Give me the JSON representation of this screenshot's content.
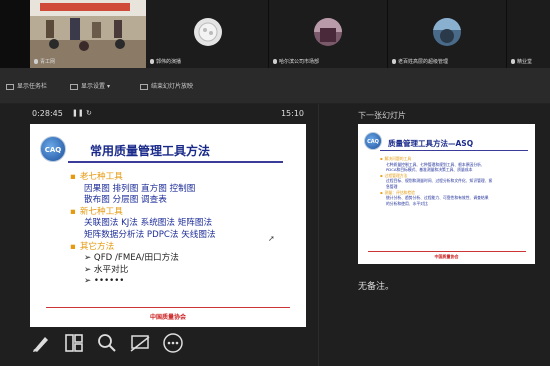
{
  "participants": [
    {
      "name": "青工网",
      "type": "video"
    },
    {
      "name": "郭伟的演播",
      "type": "avatar",
      "color": "#d8d8d8"
    },
    {
      "name": "哈尔滨公司市场部",
      "type": "avatar",
      "color": "#7a5a6a"
    },
    {
      "name": "老百姓高层的超级管理",
      "type": "avatar",
      "color": "#4a6a8a"
    },
    {
      "name": "精业堂",
      "type": "avatar",
      "color": "#3a3a3a"
    }
  ],
  "toolbar": {
    "item1": "显示任务栏",
    "item2": "显示设置",
    "item3": "结束幻灯片放映"
  },
  "presenter": {
    "elapsed": "0:28:45",
    "clock": "15:10",
    "pause_icon": "pause-icon",
    "restart_icon": "restart-icon"
  },
  "slide": {
    "logo": "CAQ",
    "title": "常用质量管理工具方法",
    "items": [
      {
        "kind": "head",
        "text": "老七种工具"
      },
      {
        "kind": "sub",
        "text": "因果图  排列图   直方图   控制图"
      },
      {
        "kind": "sub",
        "text": "散布图   分层图   调查表"
      },
      {
        "kind": "head",
        "text": "新七种工具"
      },
      {
        "kind": "sub",
        "text": "关联图法   KJ法    系统图法   矩阵图法"
      },
      {
        "kind": "sub",
        "text": "矩阵数据分析法   PDPC法   矢线图法"
      },
      {
        "kind": "head",
        "text": "其它方法"
      },
      {
        "kind": "arrow",
        "text": "➢ QFD /FMEA/田口方法"
      },
      {
        "kind": "arrow",
        "text": "➢ 水平对比"
      },
      {
        "kind": "arrow",
        "text": "➢ ••••••"
      }
    ],
    "footer": "中国质量协会"
  },
  "next_slide": {
    "label": "下一张幻灯片",
    "logo": "CAQ",
    "title": "质量管理工具方法—ASQ",
    "items": [
      {
        "kind": "h",
        "text": "解决问题的工具"
      },
      {
        "kind": "t",
        "text": "七种质量控制工具、七种管理和规划工具、根本原因分析、"
      },
      {
        "kind": "t",
        "text": "PDCA和目标模式、基准测量和决策工具、质量成本"
      },
      {
        "kind": "h",
        "text": "过程管理方法"
      },
      {
        "kind": "t",
        "text": "过程目标、规划和测量时间、过程分析和文件化、知识管理、紧"
      },
      {
        "kind": "t",
        "text": "急管理"
      },
      {
        "kind": "h",
        "text": "测量：评估和检验"
      },
      {
        "kind": "t",
        "text": "统计分析、趋势分析、过程能力、可靠性和有效性、调查结果"
      },
      {
        "kind": "t",
        "text": "的分析和使用、水平对比"
      }
    ],
    "footer": "中国质量协会"
  },
  "notes": "无备注。",
  "bottom_tools": [
    "pen-icon",
    "slides-grid-icon",
    "zoom-icon",
    "subtitle-icon",
    "more-icon"
  ]
}
